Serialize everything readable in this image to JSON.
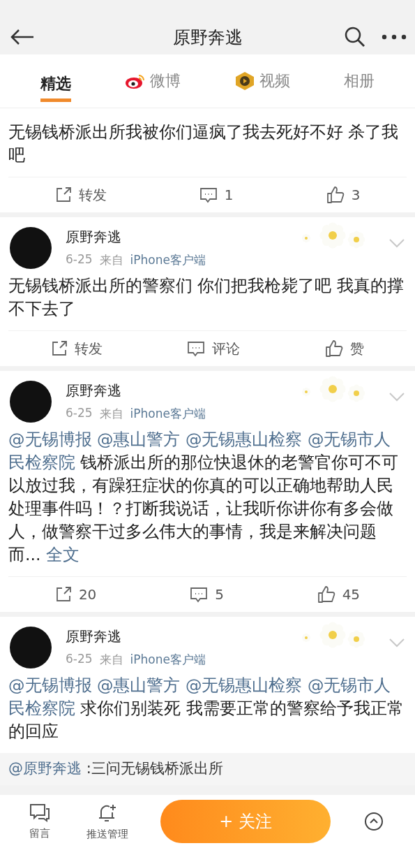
{
  "header": {
    "title": "原野奔逃"
  },
  "tabs": [
    {
      "label": "精选",
      "selected": true
    },
    {
      "label": "微博",
      "selected": false,
      "kind": "weibo"
    },
    {
      "label": "视频",
      "selected": false,
      "kind": "video"
    },
    {
      "label": "相册",
      "selected": false
    }
  ],
  "posts": [
    {
      "content": [
        {
          "kind": "plain",
          "text": "无锡钱桥派出所我被你们逼疯了我去死好不好 杀了我吧"
        }
      ],
      "actions": [
        {
          "kind": "repost",
          "label": "转发"
        },
        {
          "kind": "comment",
          "label": "1"
        },
        {
          "kind": "like",
          "label": "3"
        }
      ]
    },
    {
      "author": "原野奔逃",
      "date": "6-25",
      "via": "来自",
      "source": "iPhone客户端",
      "content": [
        {
          "kind": "plain",
          "text": "无锡钱桥派出所的警察们 你们把我枪毙了吧 我真的撑不下去了"
        }
      ],
      "actions": [
        {
          "kind": "repost",
          "label": "转发"
        },
        {
          "kind": "comment",
          "label": "评论"
        },
        {
          "kind": "like",
          "label": "赞"
        }
      ]
    },
    {
      "author": "原野奔逃",
      "date": "6-25",
      "via": "来自",
      "source": "iPhone客户端",
      "content": [
        {
          "kind": "mention",
          "text": "@无锡博报"
        },
        {
          "kind": "mention",
          "text": "@惠山警方"
        },
        {
          "kind": "mention",
          "text": "@无锡惠山检察"
        },
        {
          "kind": "mention",
          "text": "@无锡市人民检察院"
        },
        {
          "kind": "plain",
          "text": " 钱桥派出所的那位快退休的老警官你可不可以放过我，有躁狂症状的你真的可以正确地帮助人民处理事件吗！？打断我说话，让我听你讲你有多会做人，做警察干过多么伟大的事情，我是来解决问题而... "
        },
        {
          "kind": "mention",
          "text": "全文"
        }
      ],
      "actions": [
        {
          "kind": "repost",
          "label": "20"
        },
        {
          "kind": "comment",
          "label": "5"
        },
        {
          "kind": "like",
          "label": "45"
        }
      ]
    },
    {
      "author": "原野奔逃",
      "date": "6-25",
      "via": "来自",
      "source": "iPhone客户端",
      "content": [
        {
          "kind": "mention",
          "text": "@无锡博报"
        },
        {
          "kind": "mention",
          "text": "@惠山警方"
        },
        {
          "kind": "mention",
          "text": "@无锡惠山检察"
        },
        {
          "kind": "mention",
          "text": "@无锡市人民检察院"
        },
        {
          "kind": "plain",
          "text": " 求你们别装死 我需要正常的警察给予我正常的回应"
        }
      ],
      "quote": {
        "mention": "@原野奔逃",
        "text": " :三问无锡钱桥派出所"
      }
    }
  ],
  "bottom_bar": {
    "items": [
      {
        "kind": "message",
        "label": "留言"
      },
      {
        "kind": "push",
        "label": "推送管理"
      }
    ],
    "follow": "+ 关注"
  }
}
